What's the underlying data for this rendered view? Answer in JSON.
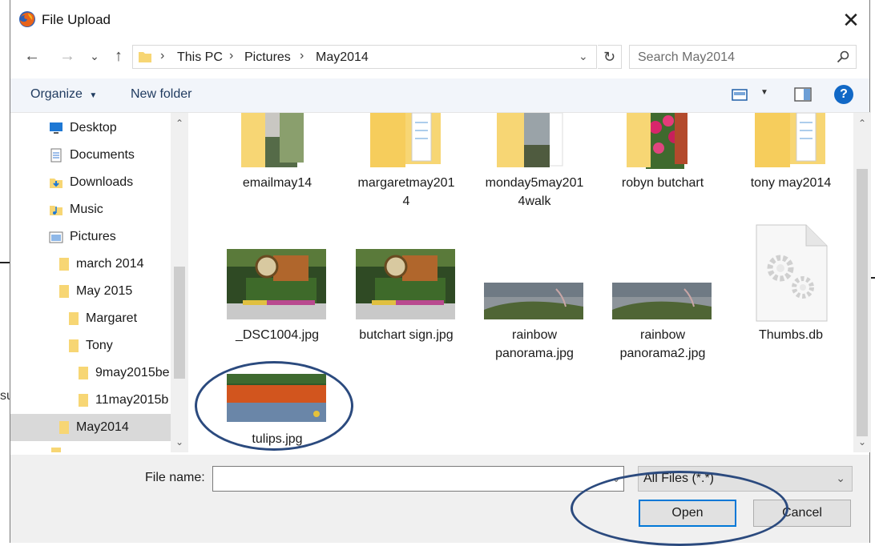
{
  "dialog": {
    "title": "File Upload",
    "close_label": "✕"
  },
  "nav": {
    "back": "←",
    "forward": "→",
    "recent": "⌄",
    "up": "↑"
  },
  "address": {
    "segments": [
      "This PC",
      "Pictures",
      "May2014"
    ],
    "refresh": "↻"
  },
  "search": {
    "placeholder": "Search May2014"
  },
  "toolbar": {
    "organize": "Organize",
    "new_folder": "New folder",
    "help": "?"
  },
  "tree": {
    "items": [
      {
        "label": "Desktop",
        "icon": "desktop-icon"
      },
      {
        "label": "Documents",
        "icon": "documents-icon"
      },
      {
        "label": "Downloads",
        "icon": "downloads-icon"
      },
      {
        "label": "Music",
        "icon": "music-icon"
      },
      {
        "label": "Pictures",
        "icon": "pictures-icon"
      },
      {
        "label": "march 2014",
        "icon": "folder-icon"
      },
      {
        "label": "May 2015",
        "icon": "folder-icon"
      },
      {
        "label": "Margaret",
        "icon": "folder-icon"
      },
      {
        "label": "Tony",
        "icon": "folder-icon"
      },
      {
        "label": "9may2015be",
        "icon": "folder-icon"
      },
      {
        "label": "11may2015b",
        "icon": "folder-icon"
      },
      {
        "label": "May2014",
        "icon": "folder-icon",
        "selected": true
      }
    ]
  },
  "files": [
    {
      "name": "emailmay14",
      "kind": "folder"
    },
    {
      "name": "margaretmay2014",
      "line1": "margaretmay201",
      "line2": "4",
      "kind": "folder"
    },
    {
      "name": "monday5may2014walk",
      "line1": "monday5may201",
      "line2": "4walk",
      "kind": "folder"
    },
    {
      "name": "robyn butchart",
      "kind": "folder"
    },
    {
      "name": "tony may2014",
      "kind": "folder"
    },
    {
      "name": "_DSC1004.jpg",
      "kind": "image"
    },
    {
      "name": "butchart sign.jpg",
      "kind": "image"
    },
    {
      "name": "rainbow panorama.jpg",
      "line1": "rainbow",
      "line2": "panorama.jpg",
      "kind": "image"
    },
    {
      "name": "rainbow panorama2.jpg",
      "line1": "rainbow",
      "line2": "panorama2.jpg",
      "kind": "image"
    },
    {
      "name": "Thumbs.db",
      "kind": "file"
    },
    {
      "name": "tulips.jpg",
      "kind": "image"
    }
  ],
  "bottom": {
    "file_name_label": "File name:",
    "file_name_value": "",
    "filter_value": "All Files (*.*)",
    "open_label": "Open",
    "cancel_label": "Cancel"
  },
  "colors": {
    "accent": "#0078d7",
    "annotation": "#2b4a7e",
    "folder": "#f7d674"
  }
}
